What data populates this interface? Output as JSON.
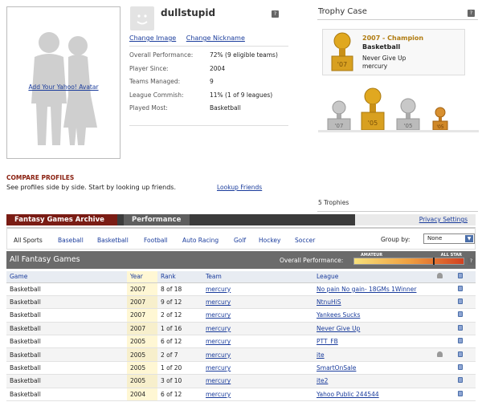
{
  "profile": {
    "add_avatar": "Add Your Yahoo! Avatar",
    "username": "dullstupid",
    "help": "?",
    "change_image": "Change Image",
    "change_nickname": "Change Nickname",
    "stats": [
      {
        "label": "Overall Performance:",
        "value": "72% (9 eligible teams)"
      },
      {
        "label": "Player Since:",
        "value": "2004"
      },
      {
        "label": "Teams Managed:",
        "value": "9"
      },
      {
        "label": "League Commish:",
        "value": "11% (1 of 9 leagues)"
      },
      {
        "label": "Played Most:",
        "value": "Basketball"
      }
    ]
  },
  "trophy_case": {
    "title": "Trophy Case",
    "help": "?",
    "champion_year": "2007 - Champion",
    "champion_sport": "Basketball",
    "champion_league": "Never Give Up",
    "champion_team": "mercury",
    "count": "5 Trophies",
    "trophy_labels": [
      "'07",
      "'07",
      "'05",
      "'05",
      "'05"
    ]
  },
  "compare": {
    "title": "COMPARE PROFILES",
    "text": "See profiles side by side. Start by looking up friends.",
    "lookup": "Lookup Friends"
  },
  "tabs": {
    "active": "Fantasy Games Archive",
    "inactive": "Performance",
    "privacy": "Privacy Settings"
  },
  "filters": {
    "items": [
      "All Sports",
      "Baseball",
      "Basketball",
      "Football",
      "Auto Racing",
      "Golf",
      "Hockey",
      "Soccer"
    ],
    "group_by_label": "Group by:",
    "group_by_value": "None"
  },
  "games": {
    "title": "All Fantasy Games",
    "overall_label": "Overall Performance:",
    "amateur": "AMATEUR",
    "all_star": "ALL STAR",
    "help": "?"
  },
  "table": {
    "headers": [
      "Game",
      "Year",
      "Rank",
      "Team",
      "League"
    ],
    "rows": [
      {
        "game": "Basketball",
        "year": "2007",
        "rank": "8 of 18",
        "team": "mercury",
        "league": "No pain No gain- 18GMs 1Winner",
        "trophy": false
      },
      {
        "game": "Basketball",
        "year": "2007",
        "rank": "9 of 12",
        "team": "mercury",
        "league": "NtnuHiS",
        "trophy": false
      },
      {
        "game": "Basketball",
        "year": "2007",
        "rank": "2 of 12",
        "team": "mercury",
        "league": "Yankees Sucks",
        "trophy": false
      },
      {
        "game": "Basketball",
        "year": "2007",
        "rank": "1 of 16",
        "team": "mercury",
        "league": "Never Give Up",
        "trophy": false
      },
      {
        "game": "Basketball",
        "year": "2005",
        "rank": "6 of 12",
        "team": "mercury",
        "league": "PTT_FB",
        "trophy": false
      },
      {
        "game": "Basketball",
        "year": "2005",
        "rank": "2 of 7",
        "team": "mercury",
        "league": "ite",
        "trophy": true
      },
      {
        "game": "Basketball",
        "year": "2005",
        "rank": "1 of 20",
        "team": "mercury",
        "league": "SmartOnSale",
        "trophy": false
      },
      {
        "game": "Basketball",
        "year": "2005",
        "rank": "3 of 10",
        "team": "mercury",
        "league": "ite2",
        "trophy": false
      },
      {
        "game": "Basketball",
        "year": "2004",
        "rank": "6 of 12",
        "team": "mercury",
        "league": "Yahoo Public 244544",
        "trophy": false
      }
    ]
  }
}
